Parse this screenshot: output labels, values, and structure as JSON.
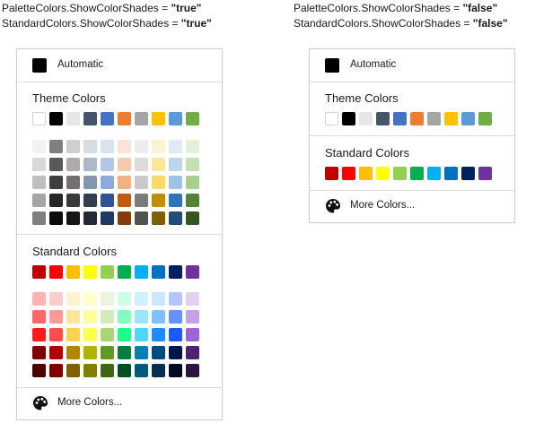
{
  "captions": {
    "left": {
      "line1_prefix": "PaletteColors.ShowColorShades = ",
      "line1_value": "\"true\"",
      "line2_prefix": "StandardColors.ShowColorShades = ",
      "line2_value": "\"true\""
    },
    "right": {
      "line1_prefix": "PaletteColors.ShowColorShades = ",
      "line1_value": "\"false\"",
      "line2_prefix": "StandardColors.ShowColorShades = ",
      "line2_value": "\"false\""
    }
  },
  "labels": {
    "automatic": "Automatic",
    "theme_colors": "Theme Colors",
    "standard_colors": "Standard Colors",
    "more_colors": "More Colors..."
  },
  "colors": {
    "automatic": "#000000",
    "theme": [
      "#FFFFFF",
      "#000000",
      "#E7E6E6",
      "#44546A",
      "#4472C4",
      "#ED7D31",
      "#A5A5A5",
      "#FFC000",
      "#5B9BD5",
      "#70AD47"
    ],
    "theme_shades": [
      [
        "#F2F2F2",
        "#7F7F7F",
        "#D0CECE",
        "#D6DCE4",
        "#D9E2F3",
        "#FBE4D5",
        "#EDEDED",
        "#FFF2CC",
        "#DEEAF6",
        "#E2EFD9"
      ],
      [
        "#D8D8D8",
        "#595959",
        "#AEAAAA",
        "#ADB9CA",
        "#B4C6E7",
        "#F7CAAC",
        "#DBDBDB",
        "#FFE598",
        "#BDD6EE",
        "#C5E0B3"
      ],
      [
        "#BFBFBF",
        "#3F3F3F",
        "#757070",
        "#8496B0",
        "#8EAADB",
        "#F4B083",
        "#C9C9C9",
        "#FFD965",
        "#9CC3E5",
        "#A8D08D"
      ],
      [
        "#A5A5A5",
        "#262626",
        "#3A3838",
        "#323F4F",
        "#2F5496",
        "#C45911",
        "#7B7B7B",
        "#BF8F00",
        "#2E75B5",
        "#538135"
      ],
      [
        "#7F7F7F",
        "#0C0C0C",
        "#171616",
        "#222A35",
        "#1F3864",
        "#843C0B",
        "#525252",
        "#7F6000",
        "#1E4E79",
        "#375623"
      ]
    ],
    "standard": [
      "#C00000",
      "#FF0000",
      "#FFC000",
      "#FFFF00",
      "#92D050",
      "#00B050",
      "#00B0F0",
      "#0070C0",
      "#002060",
      "#7030A0"
    ],
    "standard_shades": [
      [
        "#FFB3B3",
        "#FFCCCC",
        "#FFF2CC",
        "#FFFFCC",
        "#E9F5DC",
        "#CCFFE6",
        "#CCF2FF",
        "#CCE6FF",
        "#B3C6FF",
        "#E2D0F2"
      ],
      [
        "#FF6666",
        "#FF9999",
        "#FFE599",
        "#FFFF99",
        "#D3EBB9",
        "#80FFC0",
        "#99E6FF",
        "#80C0FF",
        "#6690FF",
        "#C5A1E5"
      ],
      [
        "#FF1A1A",
        "#FF4D4D",
        "#FFD24D",
        "#FFFF4D",
        "#A9D873",
        "#1AFF8C",
        "#4DD6FF",
        "#1A8CFF",
        "#1A59FF",
        "#9F63D6"
      ],
      [
        "#800000",
        "#B30000",
        "#B38600",
        "#B3B300",
        "#5F9A23",
        "#008040",
        "#0080B3",
        "#004C80",
        "#00144D",
        "#4E2270"
      ],
      [
        "#4D0000",
        "#800000",
        "#806000",
        "#808000",
        "#3F6617",
        "#004D26",
        "#005A80",
        "#002E4D",
        "#000A26",
        "#2E1443"
      ]
    ]
  },
  "icons": {
    "palette": "palette-icon"
  }
}
